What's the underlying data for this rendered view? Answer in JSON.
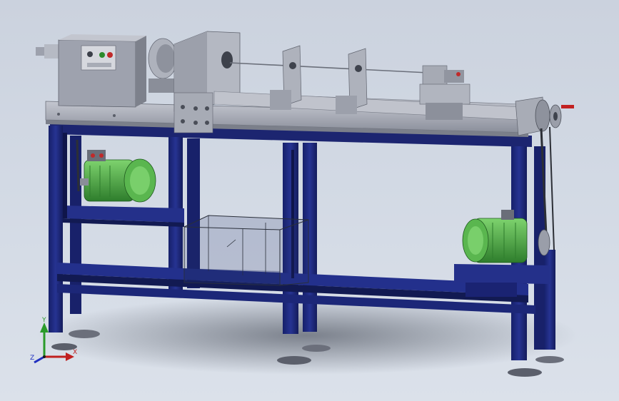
{
  "triad": {
    "x_label": "X",
    "y_label": "Y",
    "z_label": "Z"
  },
  "colors": {
    "frame_blue": "#1f2a78",
    "frame_blue_dark": "#121a52",
    "steel_gray": "#8d919e",
    "steel_light": "#b8bcc7",
    "motor_green": "#3f9a3c",
    "motor_green_light": "#66c05b",
    "handle_red": "#c22121",
    "background": "#d2d9e4"
  },
  "icons": {
    "view_triad": "xyz-triad-icon"
  }
}
